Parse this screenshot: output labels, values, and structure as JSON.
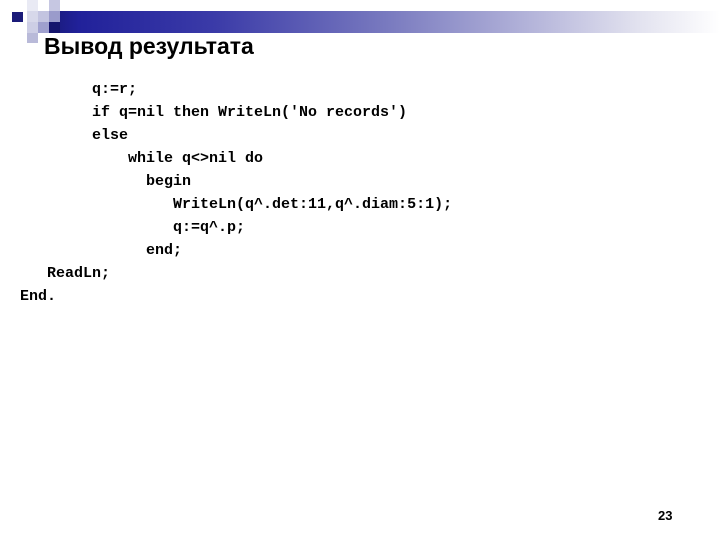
{
  "slide": {
    "title": "Вывод результата",
    "page_number": "23",
    "accent_color": "#1b1b79",
    "gradient_start": "#16176e",
    "gradient_end": "#ffffff"
  },
  "code": {
    "language": "pascal",
    "lines": [
      "        q:=r;",
      "        if q=nil then WriteLn('No records')",
      "        else",
      "            while q<>nil do",
      "              begin",
      "                 WriteLn(q^.det:11,q^.diam:5:1);",
      "                 q:=q^.p;",
      "              end;",
      "   ReadLn;",
      "End."
    ]
  },
  "decoration": {
    "squares": [
      {
        "name": "navy-square",
        "color": "#1b1b79"
      },
      {
        "name": "light-square-1",
        "color": "#e9eaf4"
      },
      {
        "name": "light-square-2",
        "color": "#c6c7e2"
      },
      {
        "name": "light-square-3",
        "color": "#d7d8ea"
      },
      {
        "name": "light-square-4",
        "color": "#c3c4e0"
      },
      {
        "name": "light-square-5",
        "color": "#9a9bcb"
      },
      {
        "name": "light-square-6",
        "color": "#cdcee5"
      },
      {
        "name": "light-square-7",
        "color": "#9fa0ce"
      },
      {
        "name": "navy-square-2",
        "color": "#15156d"
      },
      {
        "name": "light-square-8",
        "color": "#b9bad9"
      }
    ]
  }
}
